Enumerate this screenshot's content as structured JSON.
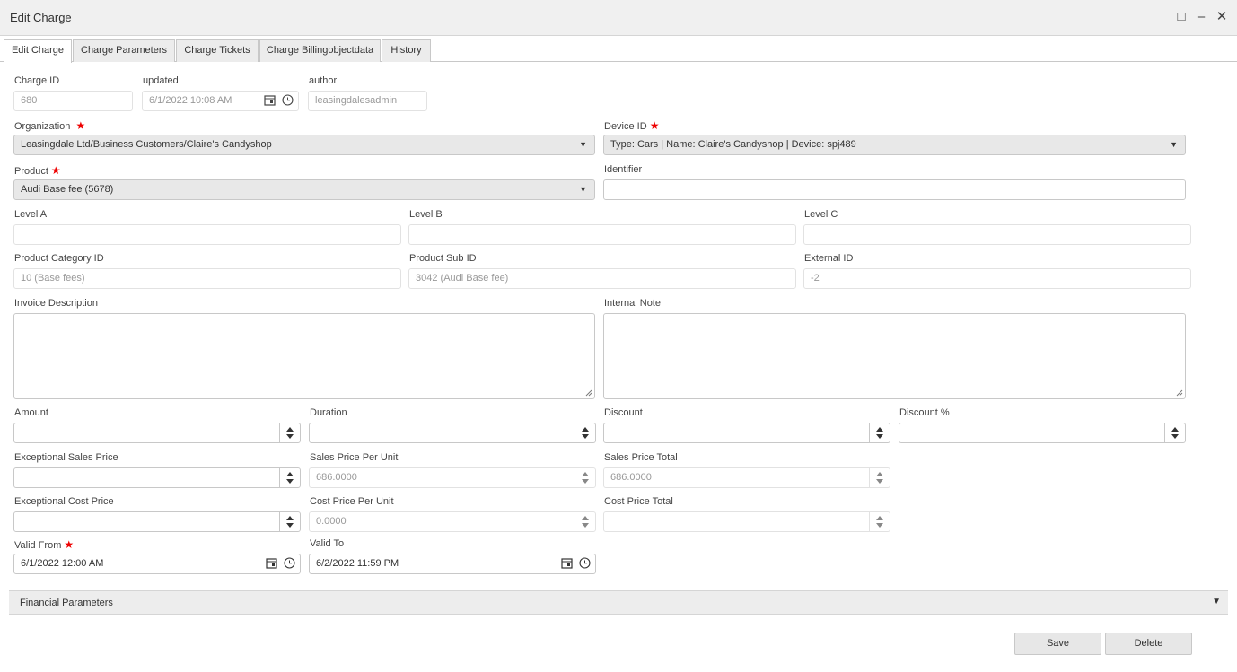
{
  "window": {
    "title": "Edit Charge"
  },
  "tabs": [
    "Edit Charge",
    "Charge Parameters",
    "Charge Tickets",
    "Charge Billingobjectdata",
    "History"
  ],
  "fields": {
    "charge_id": {
      "label": "Charge ID",
      "value": "680"
    },
    "updated": {
      "label": "updated",
      "value": "6/1/2022 10:08 AM"
    },
    "author": {
      "label": "author",
      "value": "leasingdalesadmin"
    },
    "organization": {
      "label": "Organization",
      "value": "Leasingdale Ltd/Business Customers/Claire's Candyshop"
    },
    "device_id": {
      "label": "Device ID",
      "value": "Type: Cars | Name: Claire's Candyshop | Device: spj489"
    },
    "product": {
      "label": "Product",
      "value": "Audi Base fee (5678)"
    },
    "identifier": {
      "label": "Identifier",
      "value": ""
    },
    "level_a": {
      "label": "Level A",
      "value": ""
    },
    "level_b": {
      "label": "Level B",
      "value": ""
    },
    "level_c": {
      "label": "Level C",
      "value": ""
    },
    "product_category_id": {
      "label": "Product Category ID",
      "value": "10 (Base fees)"
    },
    "product_sub_id": {
      "label": "Product Sub ID",
      "value": "3042 (Audi Base fee)"
    },
    "external_id": {
      "label": "External ID",
      "value": "-2"
    },
    "invoice_description": {
      "label": "Invoice Description",
      "value": ""
    },
    "internal_note": {
      "label": "Internal Note",
      "value": ""
    },
    "amount": {
      "label": "Amount",
      "value": ""
    },
    "duration": {
      "label": "Duration",
      "value": ""
    },
    "discount": {
      "label": "Discount",
      "value": ""
    },
    "discount_pct": {
      "label": "Discount %",
      "value": ""
    },
    "exceptional_sales_price": {
      "label": "Exceptional Sales Price",
      "value": ""
    },
    "sales_price_per_unit": {
      "label": "Sales Price Per Unit",
      "value": "686.0000"
    },
    "sales_price_total": {
      "label": "Sales Price Total",
      "value": "686.0000"
    },
    "exceptional_cost_price": {
      "label": "Exceptional Cost Price",
      "value": ""
    },
    "cost_price_per_unit": {
      "label": "Cost Price Per Unit",
      "value": "0.0000"
    },
    "cost_price_total": {
      "label": "Cost Price Total",
      "value": ""
    },
    "valid_from": {
      "label": "Valid From",
      "value": "6/1/2022 12:00 AM"
    },
    "valid_to": {
      "label": "Valid To",
      "value": "6/2/2022 11:59 PM"
    }
  },
  "required_mark": "★",
  "section": {
    "label": "Financial Parameters"
  },
  "buttons": {
    "save": "Save",
    "delete": "Delete"
  },
  "icons": {
    "maximize": "□",
    "minimize": "–",
    "close": "✕",
    "dropdown": "▼"
  }
}
